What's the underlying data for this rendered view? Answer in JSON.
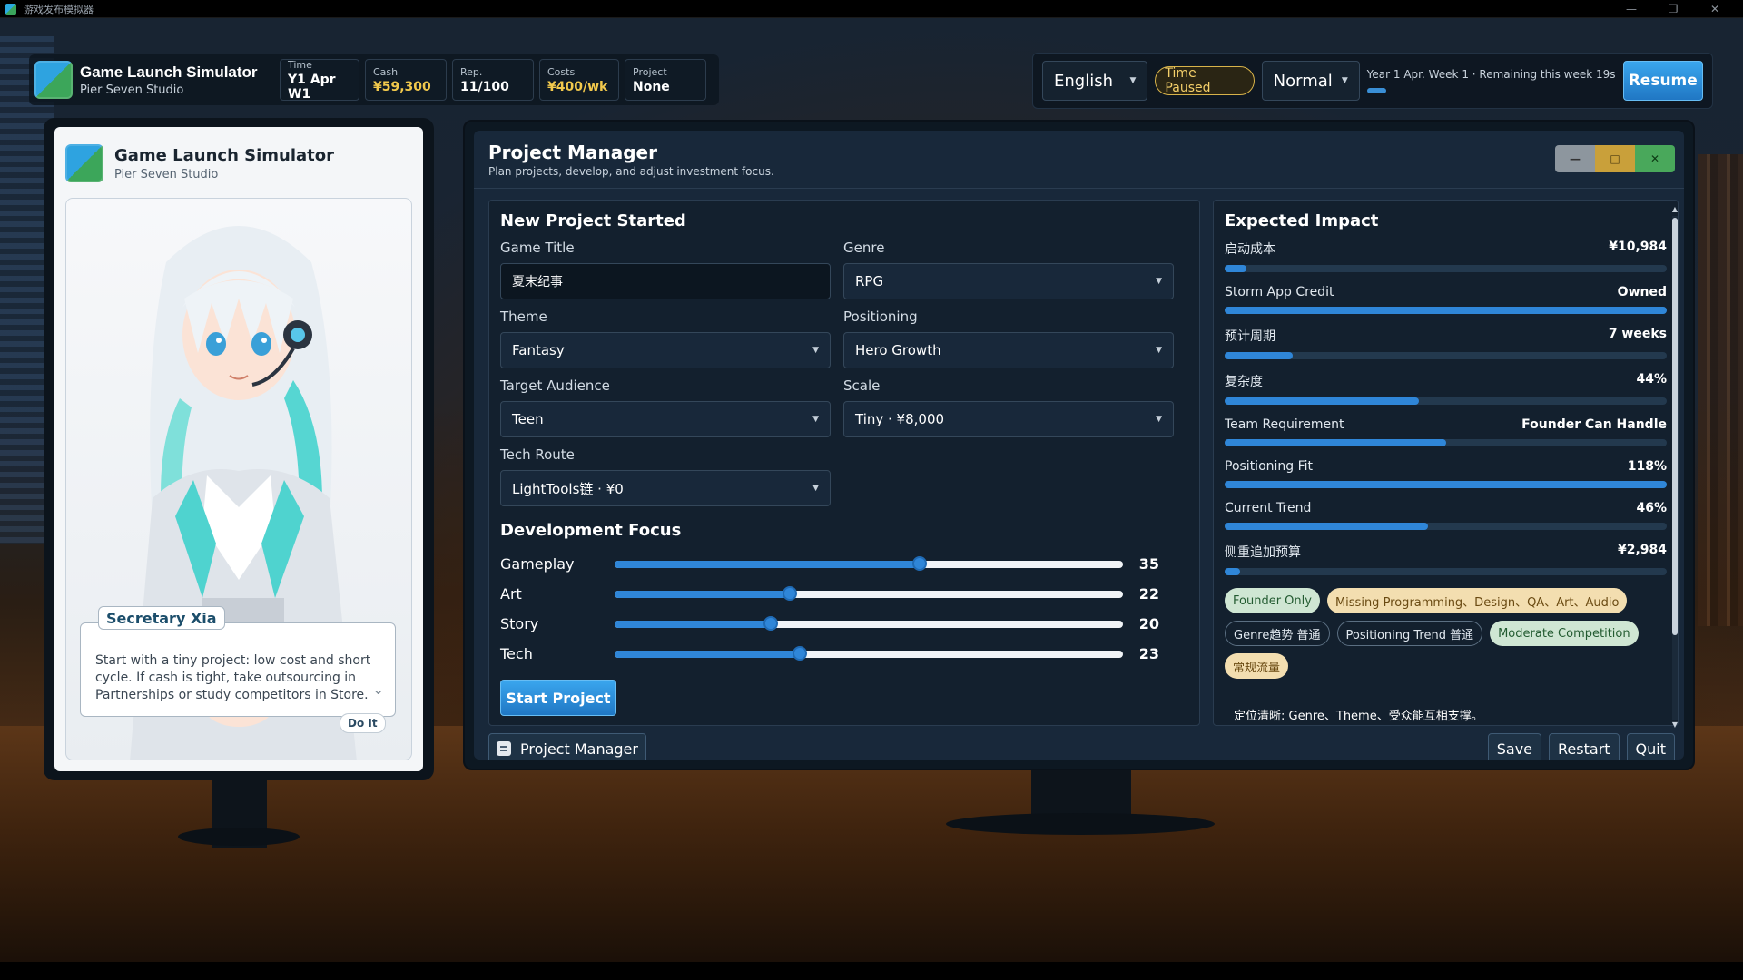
{
  "os_window": {
    "title": "游戏发布模拟器",
    "controls": [
      "—",
      "❐",
      "✕"
    ]
  },
  "brand": {
    "title": "Game Launch Simulator",
    "studio": "Pier Seven Studio"
  },
  "hud": {
    "stats": [
      {
        "label": "Time",
        "value": "Y1 Apr W1"
      },
      {
        "label": "Cash",
        "value": "¥59,300"
      },
      {
        "label": "Rep.",
        "value": "11/100"
      },
      {
        "label": "Costs",
        "value": "¥400/wk"
      },
      {
        "label": "Project",
        "value": "None"
      }
    ],
    "language": "English",
    "time_status": "Time Paused",
    "speed": "Normal",
    "week_info": "Year 1 Apr. Week 1 · Remaining this week 19s",
    "week_progress": 0.08,
    "resume_label": "Resume"
  },
  "phone": {
    "speaker": "Secretary Xia",
    "message": "Start with a tiny project: low cost and short cycle. If cash is tight, take outsourcing in Partnerships or study competitors in Store.",
    "action_label": "Do It"
  },
  "project_manager": {
    "title": "Project Manager",
    "subtitle": "Plan projects, develop, and adjust investment focus.",
    "window_controls": {
      "minimize": "—",
      "maximize": "□",
      "close": "✕"
    },
    "form": {
      "heading": "New Project Started",
      "game_title": {
        "label": "Game Title",
        "value": "夏末纪事"
      },
      "genre": {
        "label": "Genre",
        "value": "RPG"
      },
      "theme": {
        "label": "Theme",
        "value": "Fantasy"
      },
      "positioning": {
        "label": "Positioning",
        "value": "Hero Growth"
      },
      "audience": {
        "label": "Target Audience",
        "value": "Teen"
      },
      "scale": {
        "label": "Scale",
        "value": "Tiny · ¥8,000"
      },
      "tech": {
        "label": "Tech Route",
        "value": "LightTools链 · ¥0"
      }
    },
    "focus": {
      "heading": "Development Focus",
      "sliders": [
        {
          "label": "Gameplay",
          "value": 35,
          "fraction": 0.6
        },
        {
          "label": "Art",
          "value": 22,
          "fraction": 0.345
        },
        {
          "label": "Story",
          "value": 20,
          "fraction": 0.308
        },
        {
          "label": "Tech",
          "value": 23,
          "fraction": 0.365
        }
      ]
    },
    "start_label": "Start Project",
    "impact": {
      "heading": "Expected Impact",
      "rows": [
        {
          "label": "启动成本",
          "value": "¥10,984",
          "fraction": 0.05
        },
        {
          "label": "Storm App Credit",
          "value": "Owned",
          "fraction": 1.0
        },
        {
          "label": "预计周期",
          "value": "7 weeks",
          "fraction": 0.155
        },
        {
          "label": "复杂度",
          "value": "44%",
          "fraction": 0.44
        },
        {
          "label": "Team Requirement",
          "value": "Founder Can Handle",
          "fraction": 0.5
        },
        {
          "label": "Positioning Fit",
          "value": "118%",
          "fraction": 1.0
        },
        {
          "label": "Current Trend",
          "value": "46%",
          "fraction": 0.46
        },
        {
          "label": "侧重追加预算",
          "value": "¥2,984",
          "fraction": 0.035
        }
      ],
      "tags": [
        {
          "text": "Founder Only",
          "style": "green"
        },
        {
          "text": "Missing Programming、Design、QA、Art、Audio",
          "style": "gold"
        },
        {
          "text": "Genre趋势 普通",
          "style": "dark"
        },
        {
          "text": "Positioning Trend 普通",
          "style": "dark"
        },
        {
          "text": "Moderate Competition",
          "style": "green"
        },
        {
          "text": "常规流量",
          "style": "gold"
        }
      ],
      "note": "定位清晰: Genre、Theme、受众能互相支撑。"
    },
    "footer": {
      "tab_label": "Project Manager",
      "save": "Save",
      "restart": "Restart",
      "quit": "Quit"
    }
  }
}
